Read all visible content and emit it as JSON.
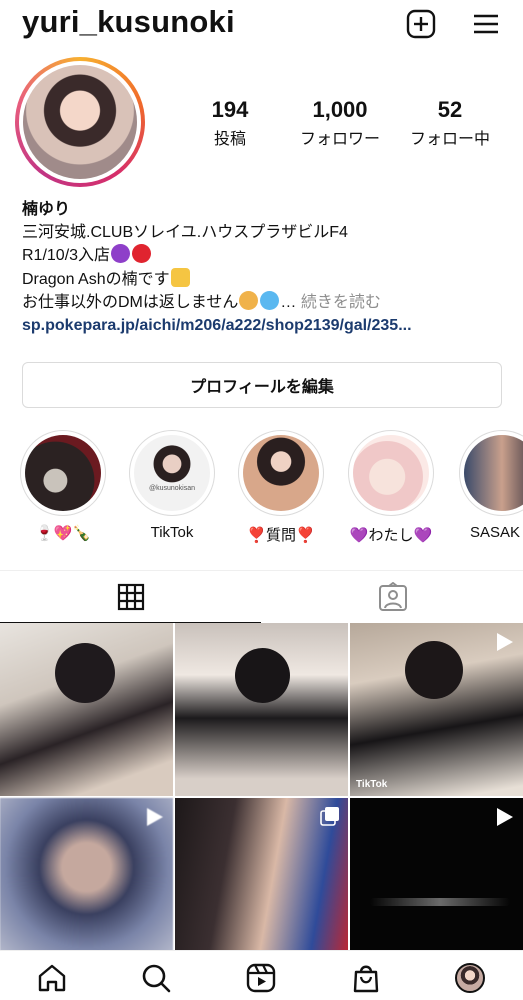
{
  "header": {
    "username": "yuri_kusunoki",
    "icons": [
      "new-post-icon",
      "menu-icon"
    ]
  },
  "stats": [
    {
      "value": "194",
      "label": "投稿"
    },
    {
      "value": "1,000",
      "label": "フォロワー"
    },
    {
      "value": "52",
      "label": "フォロー中"
    }
  ],
  "bio": {
    "name": "楠ゆり",
    "line1": "三河安城.CLUBソレイユ.ハウスプラザビルF4",
    "line2": "R1/10/3入店",
    "line3": "Dragon Ashの楠です",
    "line4": "お仕事以外のDMは返しません",
    "ellipsis": "…",
    "more": "続きを読む",
    "link": "sp.pokepara.jp/aichi/m206/a222/shop2139/gal/235..."
  },
  "edit_profile_label": "プロフィールを編集",
  "highlights": [
    {
      "label": "🍷💖🍾"
    },
    {
      "label": "TikTok",
      "caption": "@kusunokisan"
    },
    {
      "label": "❣️質問❣️"
    },
    {
      "label": "💜わたし💜"
    },
    {
      "label": "SASAK"
    }
  ],
  "tiktok_label": "TikTok",
  "nav": [
    "home-icon",
    "search-icon",
    "reels-icon",
    "shop-icon",
    "profile-avatar"
  ],
  "colors": {
    "link": "#1c3b6e",
    "muted": "#8e8e8e",
    "border": "#dbdbdb",
    "story_ring": "#d62e6a"
  }
}
